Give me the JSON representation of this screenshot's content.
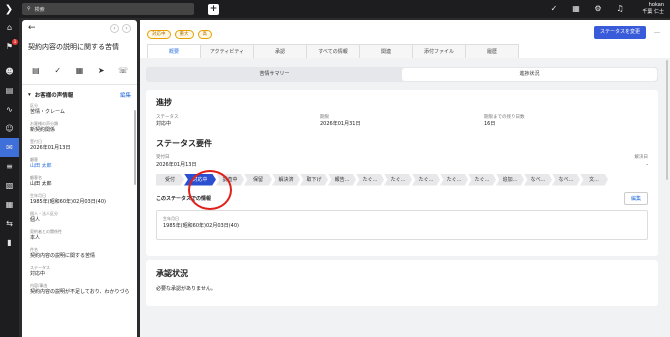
{
  "search": {
    "placeholder": "検索"
  },
  "user": {
    "line1": "hokan",
    "line2": "千葉 仁士"
  },
  "notifications": {
    "count": "1"
  },
  "left": {
    "title": "契約内容の説明に関する苦情",
    "section_title": "お客様の声情報",
    "edit_label": "編集",
    "fields": [
      {
        "k": "区分",
        "v": "苦情・クレーム",
        "link": false
      },
      {
        "k": "お客様の声分類",
        "v": "新契約関係",
        "link": false
      },
      {
        "k": "受付日",
        "v": "2026年01月13日",
        "link": false
      },
      {
        "k": "顧客",
        "v": "山田 太郎",
        "link": true
      },
      {
        "k": "顧客名",
        "v": "山田 太郎",
        "link": false
      },
      {
        "k": "生年月日",
        "v": "1985年(昭和60年)02月03日(40)",
        "link": false
      },
      {
        "k": "個人・法人区分",
        "v": "個人",
        "link": false
      },
      {
        "k": "契約者との関係性",
        "v": "本人",
        "link": false
      },
      {
        "k": "件名",
        "v": "契約内容の説明に関する苦情",
        "link": false
      },
      {
        "k": "ステータス",
        "v": "対応中",
        "link": false
      },
      {
        "k": "内容/事由",
        "v": "契約内容の説明が不足しており、わかりづら",
        "link": false
      }
    ]
  },
  "header": {
    "tags": [
      "対応中",
      "重大",
      "高"
    ],
    "change_status": "ステータスを変更",
    "more": "…",
    "tabs": [
      "概要",
      "アクティビティ",
      "承認",
      "すべての情報",
      "関連",
      "添付ファイル",
      "履歴"
    ],
    "active_tab": 0
  },
  "segments": {
    "items": [
      "苦情サマリー",
      "進捗状況"
    ],
    "active": 1
  },
  "progress": {
    "title": "進捗",
    "cols": [
      {
        "k": "ステータス",
        "v": "対応中"
      },
      {
        "k": "期限",
        "v": "2026年01月31日"
      },
      {
        "k": "期限までの残り日数",
        "v": "16日"
      }
    ]
  },
  "requirements": {
    "title": "ステータス要件",
    "left_k": "受付日",
    "left_v": "2026年01月13日",
    "right_k": "解決日",
    "right_v": "-",
    "steps": [
      "受付",
      "対応中",
      "調査中",
      "保留",
      "解決済",
      "取下げ",
      "報告...",
      "たぐ...",
      "たぐ...",
      "たぐ...",
      "たぐ...",
      "たぐ...",
      "追加...",
      "なべ...",
      "なべ...",
      "文..."
    ],
    "current_step": 1,
    "sub_title": "このステータスでの情報",
    "sub_edit": "編集",
    "box_k": "生年月日",
    "box_v": "1985年(昭和60年)02月03日(40)"
  },
  "approval": {
    "title": "承認状況",
    "text": "必要な承認がありません。"
  }
}
